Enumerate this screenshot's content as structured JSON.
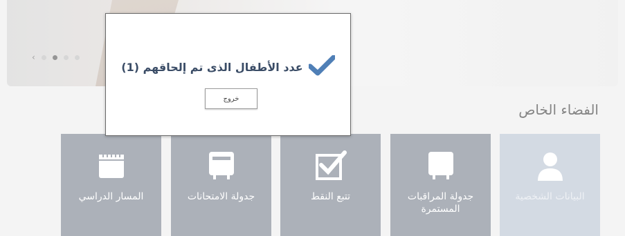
{
  "banner": {
    "carousel": {
      "prev_symbol": "‹",
      "dot_count": 4,
      "active_index": 1
    }
  },
  "section": {
    "title": "الفضاء الخاص"
  },
  "tiles": [
    {
      "label": "البيانات الشخصية",
      "icon": "person-icon"
    },
    {
      "label": "جدولة المراقبات المستمرة",
      "icon": "monitor-icon"
    },
    {
      "label": "تتبع النقط",
      "icon": "checkbox-icon"
    },
    {
      "label": "جدولة الامتحانات",
      "icon": "exam-board-icon"
    },
    {
      "label": "المسار الدراسي",
      "icon": "notebook-icon"
    }
  ],
  "modal": {
    "message": "عدد الأطفال الذى تم إلحاقهم (1)",
    "icon": "checkmark-icon",
    "exit_label": "خروج"
  },
  "colors": {
    "tile": "#8c949f",
    "tile_light": "#c3ccd9",
    "check": "#4f7fb6",
    "message_text": "#3a4c66"
  }
}
